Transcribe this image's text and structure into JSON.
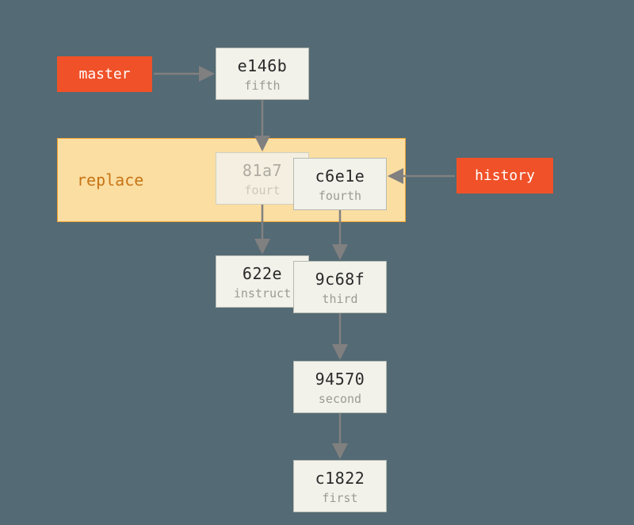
{
  "refs": {
    "master": "master",
    "history": "history"
  },
  "replace_label": "replace",
  "commits": {
    "e146b": {
      "hash": "e146b",
      "msg": "fifth"
    },
    "81a7": {
      "hash": "81a7",
      "msg": "fourt"
    },
    "c6e1e": {
      "hash": "c6e1e",
      "msg": "fourth"
    },
    "622e": {
      "hash": "622e",
      "msg": "instruct"
    },
    "9c68f": {
      "hash": "9c68f",
      "msg": "third"
    },
    "94570": {
      "hash": "94570",
      "msg": "second"
    },
    "c1822": {
      "hash": "c1822",
      "msg": "first"
    }
  },
  "colors": {
    "bg": "#546a74",
    "commit_bg": "#f2f2eb",
    "commit_border": "#b5bbb2",
    "ref_bg": "#f05128",
    "replace_bg": "#fbdea2",
    "replace_border": "#f3a536",
    "arrow": "#808080"
  }
}
